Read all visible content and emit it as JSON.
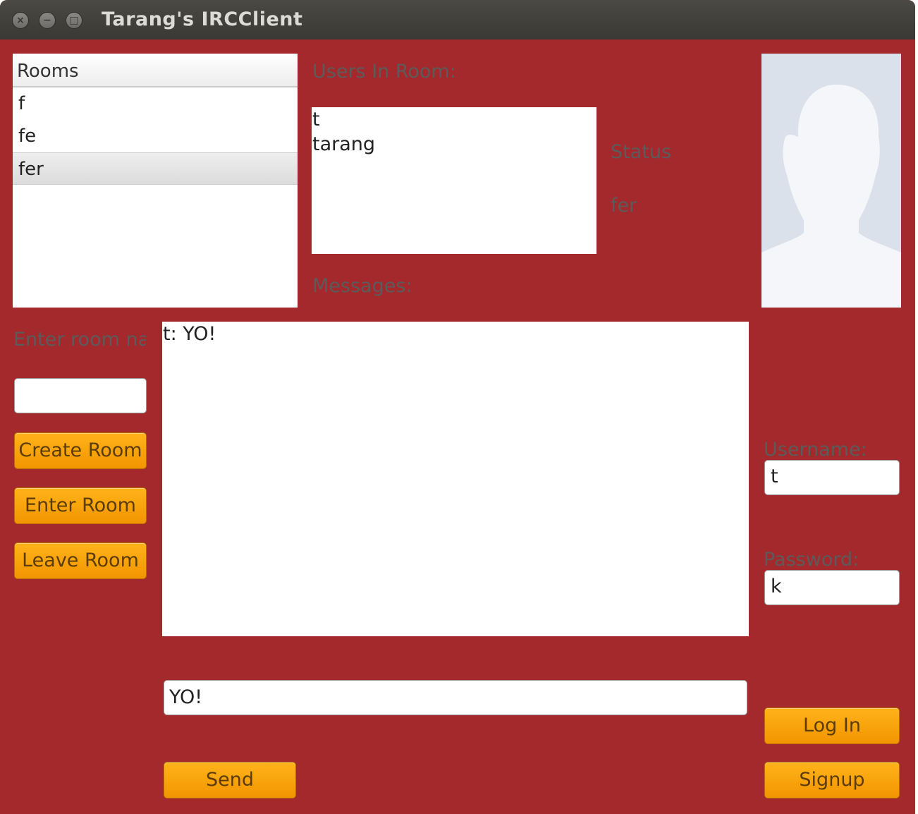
{
  "window": {
    "title": "Tarang's IRCClient"
  },
  "rooms": {
    "header": "Rooms",
    "items": [
      "f",
      "fe",
      "fer"
    ],
    "selected": "fer"
  },
  "users": {
    "label": "Users In Room:",
    "items": [
      "t",
      "tarang"
    ]
  },
  "status": {
    "label": "Status",
    "value": "fer"
  },
  "messages": {
    "label": "Messages:",
    "lines": [
      "t: YO!"
    ]
  },
  "room_entry": {
    "label": "Enter room na",
    "value": ""
  },
  "buttons": {
    "create_room": "Create Room",
    "enter_room": "Enter Room",
    "leave_room": "Leave Room",
    "send": "Send",
    "log_in": "Log In",
    "signup": "Signup"
  },
  "compose": {
    "value": "YO!"
  },
  "login": {
    "username_label": "Username:",
    "username_value": "t",
    "password_label": "Password:",
    "password_value": "k"
  },
  "colors": {
    "background": "#a4292c",
    "button": "#ffa500",
    "label": "#5b5b5b"
  }
}
